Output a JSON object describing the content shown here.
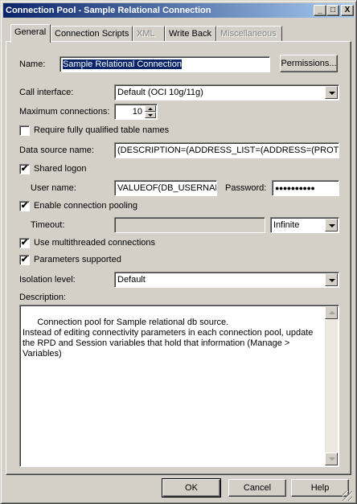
{
  "window": {
    "title": "Connection Pool - Sample Relational Connection",
    "minimize_glyph": "_",
    "maximize_glyph": "□",
    "close_glyph": "X"
  },
  "tabs": [
    {
      "label": "General",
      "active": true,
      "enabled": true
    },
    {
      "label": "Connection Scripts",
      "active": false,
      "enabled": true
    },
    {
      "label": "XML",
      "active": false,
      "enabled": false
    },
    {
      "label": "Write Back",
      "active": false,
      "enabled": true
    },
    {
      "label": "Miscellaneous",
      "active": false,
      "enabled": false
    }
  ],
  "general": {
    "name_label": "Name:",
    "name_value": "Sample Relational Connection",
    "permissions_label": "Permissions...",
    "call_interface_label": "Call interface:",
    "call_interface_value": "Default (OCI 10g/11g)",
    "max_connections_label": "Maximum connections:",
    "max_connections_value": "10",
    "require_fq_label": "Require fully qualified table names",
    "require_fq_checked": false,
    "data_source_label": "Data source name:",
    "data_source_value": "(DESCRIPTION=(ADDRESS_LIST=(ADDRESS=(PROTO",
    "shared_logon_label": "Shared logon",
    "shared_logon_checked": true,
    "user_name_label": "User name:",
    "user_name_value": "VALUEOF(DB_USERNAM",
    "password_label": "Password:",
    "password_value": "●●●●●●●●●●",
    "enable_pooling_label": "Enable connection pooling",
    "enable_pooling_checked": true,
    "timeout_label": "Timeout:",
    "timeout_value": "",
    "timeout_unit": "Infinite",
    "multithreaded_label": "Use multithreaded connections",
    "multithreaded_checked": true,
    "params_supported_label": "Parameters supported",
    "params_supported_checked": true,
    "isolation_label": "Isolation level:",
    "isolation_value": "Default",
    "description_label": "Description:",
    "description_value": "Connection pool for Sample relational db source.\nInstead of editing connectivity parameters in each connection pool, update the RPD and Session variables that hold that information (Manage > Variables)"
  },
  "buttons": {
    "ok": "OK",
    "cancel": "Cancel",
    "help": "Help"
  },
  "check_glyph": "✔"
}
